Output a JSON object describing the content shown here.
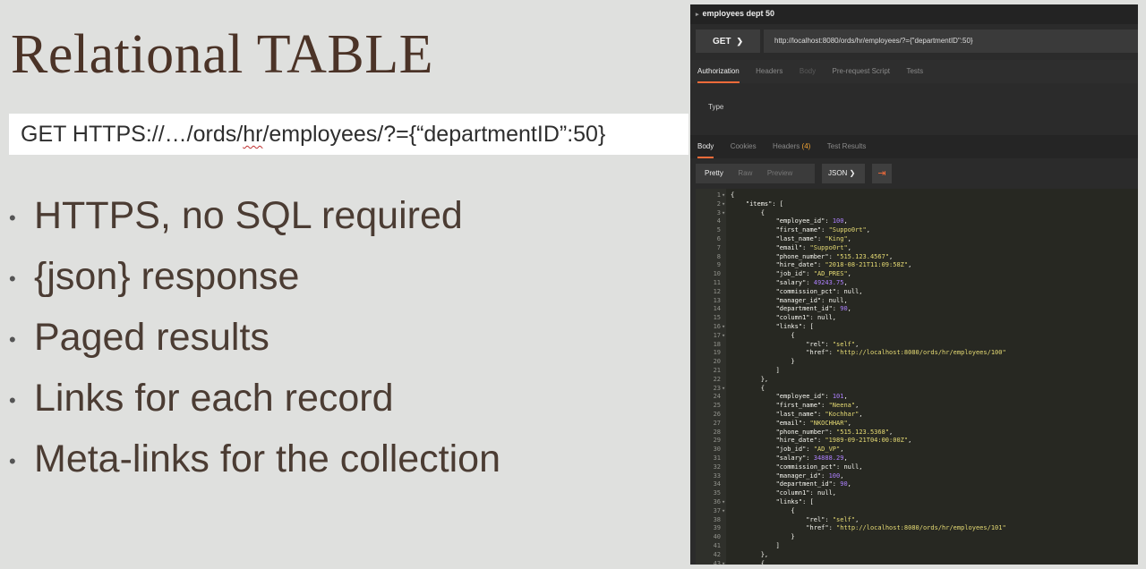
{
  "slide": {
    "title": "Relational TABLE",
    "request_url": {
      "before": "GET HTTPS://…/ords/",
      "underlined": "hr",
      "after": "/employees/?={“departmentID”:50}"
    },
    "bullet_glyph": "•",
    "bullets": [
      "HTTPS, no SQL required",
      "{json} response",
      "Paged results",
      "Links for each record",
      "Meta-links for the collection"
    ]
  },
  "postman": {
    "request_name": "employees dept 50",
    "method": "GET",
    "url": "http://localhost:8080/ords/hr/employees/?={\"departmentID\":50}",
    "request_tabs": [
      "Authorization",
      "Headers",
      "Body",
      "Pre-request Script",
      "Tests"
    ],
    "auth_type_label": "Type",
    "response_tabs": {
      "body": "Body",
      "cookies": "Cookies",
      "headers": "Headers",
      "headers_count": "(4)",
      "tests": "Test Results"
    },
    "view_modes": [
      "Pretty",
      "Raw",
      "Preview"
    ],
    "format": "JSON",
    "colors": {
      "accent": "#f26b3a",
      "string": "#e6db74",
      "number": "#ae81ff",
      "count": "#f4a534"
    },
    "code_lines": [
      {
        "n": "1",
        "f": "▾",
        "t": "{"
      },
      {
        "n": "2",
        "f": "▾",
        "t": "    \"items\": ["
      },
      {
        "n": "3",
        "f": "▾",
        "t": "        {"
      },
      {
        "n": "4",
        "f": "",
        "t": "            \"employee_id\": 100,"
      },
      {
        "n": "5",
        "f": "",
        "t": "            \"first_name\": \"Suppo0rt\","
      },
      {
        "n": "6",
        "f": "",
        "t": "            \"last_name\": \"King\","
      },
      {
        "n": "7",
        "f": "",
        "t": "            \"email\": \"Suppo0rt\","
      },
      {
        "n": "8",
        "f": "",
        "t": "            \"phone_number\": \"515.123.4567\","
      },
      {
        "n": "9",
        "f": "",
        "t": "            \"hire_date\": \"2018-08-21T11:09:58Z\","
      },
      {
        "n": "10",
        "f": "",
        "t": "            \"job_id\": \"AD_PRES\","
      },
      {
        "n": "11",
        "f": "",
        "t": "            \"salary\": 49243.75,"
      },
      {
        "n": "12",
        "f": "",
        "t": "            \"commission_pct\": null,"
      },
      {
        "n": "13",
        "f": "",
        "t": "            \"manager_id\": null,"
      },
      {
        "n": "14",
        "f": "",
        "t": "            \"department_id\": 90,"
      },
      {
        "n": "15",
        "f": "",
        "t": "            \"column1\": null,"
      },
      {
        "n": "16",
        "f": "▾",
        "t": "            \"links\": ["
      },
      {
        "n": "17",
        "f": "▾",
        "t": "                {"
      },
      {
        "n": "18",
        "f": "",
        "t": "                    \"rel\": \"self\","
      },
      {
        "n": "19",
        "f": "",
        "t": "                    \"href\": \"http://localhost:8080/ords/hr/employees/100\""
      },
      {
        "n": "20",
        "f": "",
        "t": "                }"
      },
      {
        "n": "21",
        "f": "",
        "t": "            ]"
      },
      {
        "n": "22",
        "f": "",
        "t": "        },"
      },
      {
        "n": "23",
        "f": "▾",
        "t": "        {"
      },
      {
        "n": "24",
        "f": "",
        "t": "            \"employee_id\": 101,"
      },
      {
        "n": "25",
        "f": "",
        "t": "            \"first_name\": \"Neena\","
      },
      {
        "n": "26",
        "f": "",
        "t": "            \"last_name\": \"Kochhar\","
      },
      {
        "n": "27",
        "f": "",
        "t": "            \"email\": \"NKOCHHAR\","
      },
      {
        "n": "28",
        "f": "",
        "t": "            \"phone_number\": \"515.123.5368\","
      },
      {
        "n": "29",
        "f": "",
        "t": "            \"hire_date\": \"1989-09-21T04:00:00Z\","
      },
      {
        "n": "30",
        "f": "",
        "t": "            \"job_id\": \"AD_VP\","
      },
      {
        "n": "31",
        "f": "",
        "t": "            \"salary\": 34888.29,"
      },
      {
        "n": "32",
        "f": "",
        "t": "            \"commission_pct\": null,"
      },
      {
        "n": "33",
        "f": "",
        "t": "            \"manager_id\": 100,"
      },
      {
        "n": "34",
        "f": "",
        "t": "            \"department_id\": 90,"
      },
      {
        "n": "35",
        "f": "",
        "t": "            \"column1\": null,"
      },
      {
        "n": "36",
        "f": "▾",
        "t": "            \"links\": ["
      },
      {
        "n": "37",
        "f": "▾",
        "t": "                {"
      },
      {
        "n": "38",
        "f": "",
        "t": "                    \"rel\": \"self\","
      },
      {
        "n": "39",
        "f": "",
        "t": "                    \"href\": \"http://localhost:8080/ords/hr/employees/101\""
      },
      {
        "n": "40",
        "f": "",
        "t": "                }"
      },
      {
        "n": "41",
        "f": "",
        "t": "            ]"
      },
      {
        "n": "42",
        "f": "",
        "t": "        },"
      },
      {
        "n": "43",
        "f": "▾",
        "t": "        {"
      }
    ]
  }
}
